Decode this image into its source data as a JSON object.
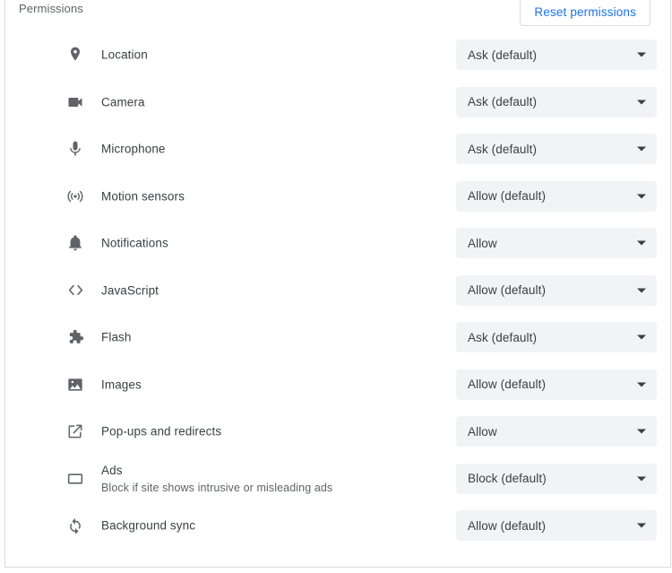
{
  "header": {
    "title": "Permissions",
    "reset_label": "Reset permissions"
  },
  "colors": {
    "link": "#1a73e8",
    "label_text": "#3c4043",
    "muted_text": "#5f6368",
    "select_bg": "#f1f3f4",
    "border": "#dadce0",
    "icon": "#5f6368"
  },
  "permissions": [
    {
      "icon": "location-pin-icon",
      "label": "Location",
      "sub": "",
      "value": "Ask (default)"
    },
    {
      "icon": "video-camera-icon",
      "label": "Camera",
      "sub": "",
      "value": "Ask (default)"
    },
    {
      "icon": "microphone-icon",
      "label": "Microphone",
      "sub": "",
      "value": "Ask (default)"
    },
    {
      "icon": "motion-sensors-icon",
      "label": "Motion sensors",
      "sub": "",
      "value": "Allow (default)"
    },
    {
      "icon": "bell-icon",
      "label": "Notifications",
      "sub": "",
      "value": "Allow"
    },
    {
      "icon": "code-brackets-icon",
      "label": "JavaScript",
      "sub": "",
      "value": "Allow (default)"
    },
    {
      "icon": "puzzle-piece-icon",
      "label": "Flash",
      "sub": "",
      "value": "Ask (default)"
    },
    {
      "icon": "image-icon",
      "label": "Images",
      "sub": "",
      "value": "Allow (default)"
    },
    {
      "icon": "open-in-new-icon",
      "label": "Pop-ups and redirects",
      "sub": "",
      "value": "Allow"
    },
    {
      "icon": "ads-rectangle-icon",
      "label": "Ads",
      "sub": "Block if site shows intrusive or misleading ads",
      "value": "Block (default)"
    },
    {
      "icon": "sync-icon",
      "label": "Background sync",
      "sub": "",
      "value": "Allow (default)"
    }
  ]
}
